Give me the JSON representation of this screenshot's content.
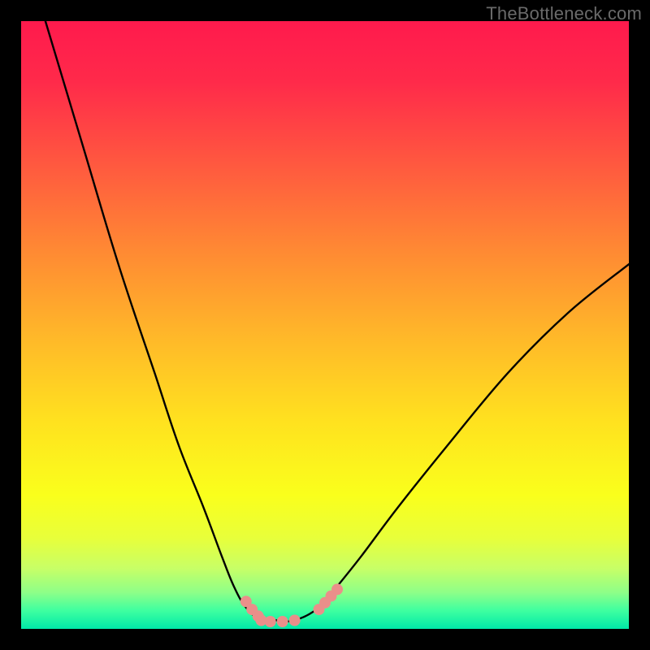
{
  "watermark": "TheBottleneck.com",
  "chart_data": {
    "type": "line",
    "title": "",
    "xlabel": "",
    "ylabel": "",
    "xlim": [
      0,
      100
    ],
    "ylim": [
      0,
      100
    ],
    "series": [
      {
        "name": "bottleneck-curve",
        "x": [
          4,
          10,
          16,
          22,
          26,
          30,
          33,
          35,
          37,
          39.5,
          42,
          45,
          49,
          52,
          56,
          62,
          70,
          80,
          90,
          100
        ],
        "y": [
          100,
          80,
          60,
          42,
          30,
          20,
          12,
          7,
          3.5,
          1.4,
          1.4,
          1.4,
          3.5,
          7,
          12,
          20,
          30,
          42,
          52,
          60
        ]
      }
    ],
    "markers": [
      {
        "name": "left-descent-marker",
        "x": [
          37,
          38,
          39,
          39.5
        ],
        "y": [
          4.5,
          3.2,
          2.1,
          1.4
        ]
      },
      {
        "name": "valley-floor-marker",
        "x": [
          41,
          43,
          45
        ],
        "y": [
          1.2,
          1.2,
          1.4
        ]
      },
      {
        "name": "right-ascent-marker",
        "x": [
          49,
          50,
          51,
          52
        ],
        "y": [
          3.2,
          4.3,
          5.4,
          6.5
        ]
      }
    ],
    "colors": {
      "curve": "#000000",
      "marker": "#ea8f8a",
      "gradient_top": "#ff1a4d",
      "gradient_bottom": "#00e8a8"
    }
  }
}
